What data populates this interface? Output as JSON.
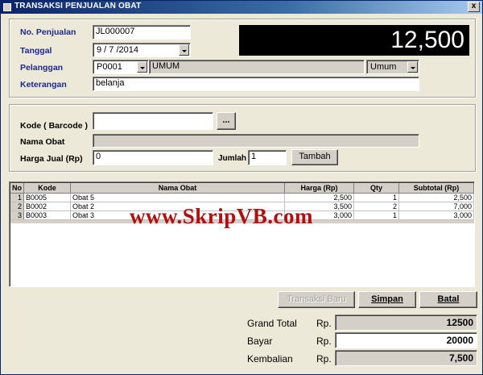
{
  "window": {
    "title": "TRANSAKSI PENJUALAN OBAT",
    "close_label": "x"
  },
  "header": {
    "no_penjualan_label": "No. Penjualan",
    "no_penjualan_value": "JL000007",
    "tanggal_label": "Tanggal",
    "tanggal_value": "9 / 7 /2014",
    "pelanggan_label": "Pelanggan",
    "pelanggan_code": "P0001",
    "pelanggan_name": "UMUM",
    "pelanggan_type": "Umum",
    "keterangan_label": "Keterangan",
    "keterangan_value": "belanja",
    "display_total": "12,500"
  },
  "entry": {
    "kode_label": "Kode ( Barcode )",
    "kode_value": "",
    "browse_label": "...",
    "nama_label": "Nama Obat",
    "nama_value": "",
    "harga_label": "Harga Jual (Rp)",
    "harga_value": "0",
    "jumlah_label": "Jumlah",
    "jumlah_value": "1",
    "tambah_label": "Tambah"
  },
  "grid": {
    "columns": [
      "No",
      "Kode",
      "Nama Obat",
      "Harga (Rp)",
      "Qty",
      "Subtotal (Rp)"
    ],
    "rows": [
      {
        "no": "1",
        "kode": "B0005",
        "nama": "Obat 5",
        "harga": "2,500",
        "qty": "1",
        "subtotal": "2,500"
      },
      {
        "no": "2",
        "kode": "B0002",
        "nama": "Obat 2",
        "harga": "3,500",
        "qty": "2",
        "subtotal": "7,000"
      },
      {
        "no": "3",
        "kode": "B0003",
        "nama": "Obat 3",
        "harga": "3,000",
        "qty": "1",
        "subtotal": "3,000"
      }
    ]
  },
  "watermark": "www.SkripVB.com",
  "actions": {
    "transaksi_baru_label": "Transaksi Baru",
    "simpan_label": "Simpan",
    "batal_label": "Batal"
  },
  "totals": {
    "grand_total_label": "Grand Total",
    "grand_total_currency": "Rp.",
    "grand_total_value": "12500",
    "bayar_label": "Bayar",
    "bayar_currency": "Rp.",
    "bayar_value": "20000",
    "kembalian_label": "Kembalian",
    "kembalian_currency": "Rp.",
    "kembalian_value": "7,500"
  },
  "colors": {
    "title_bar": "#0a246a",
    "label_blue": "#1c2a8c",
    "watermark": "#b01010",
    "face": "#ece9d8"
  }
}
